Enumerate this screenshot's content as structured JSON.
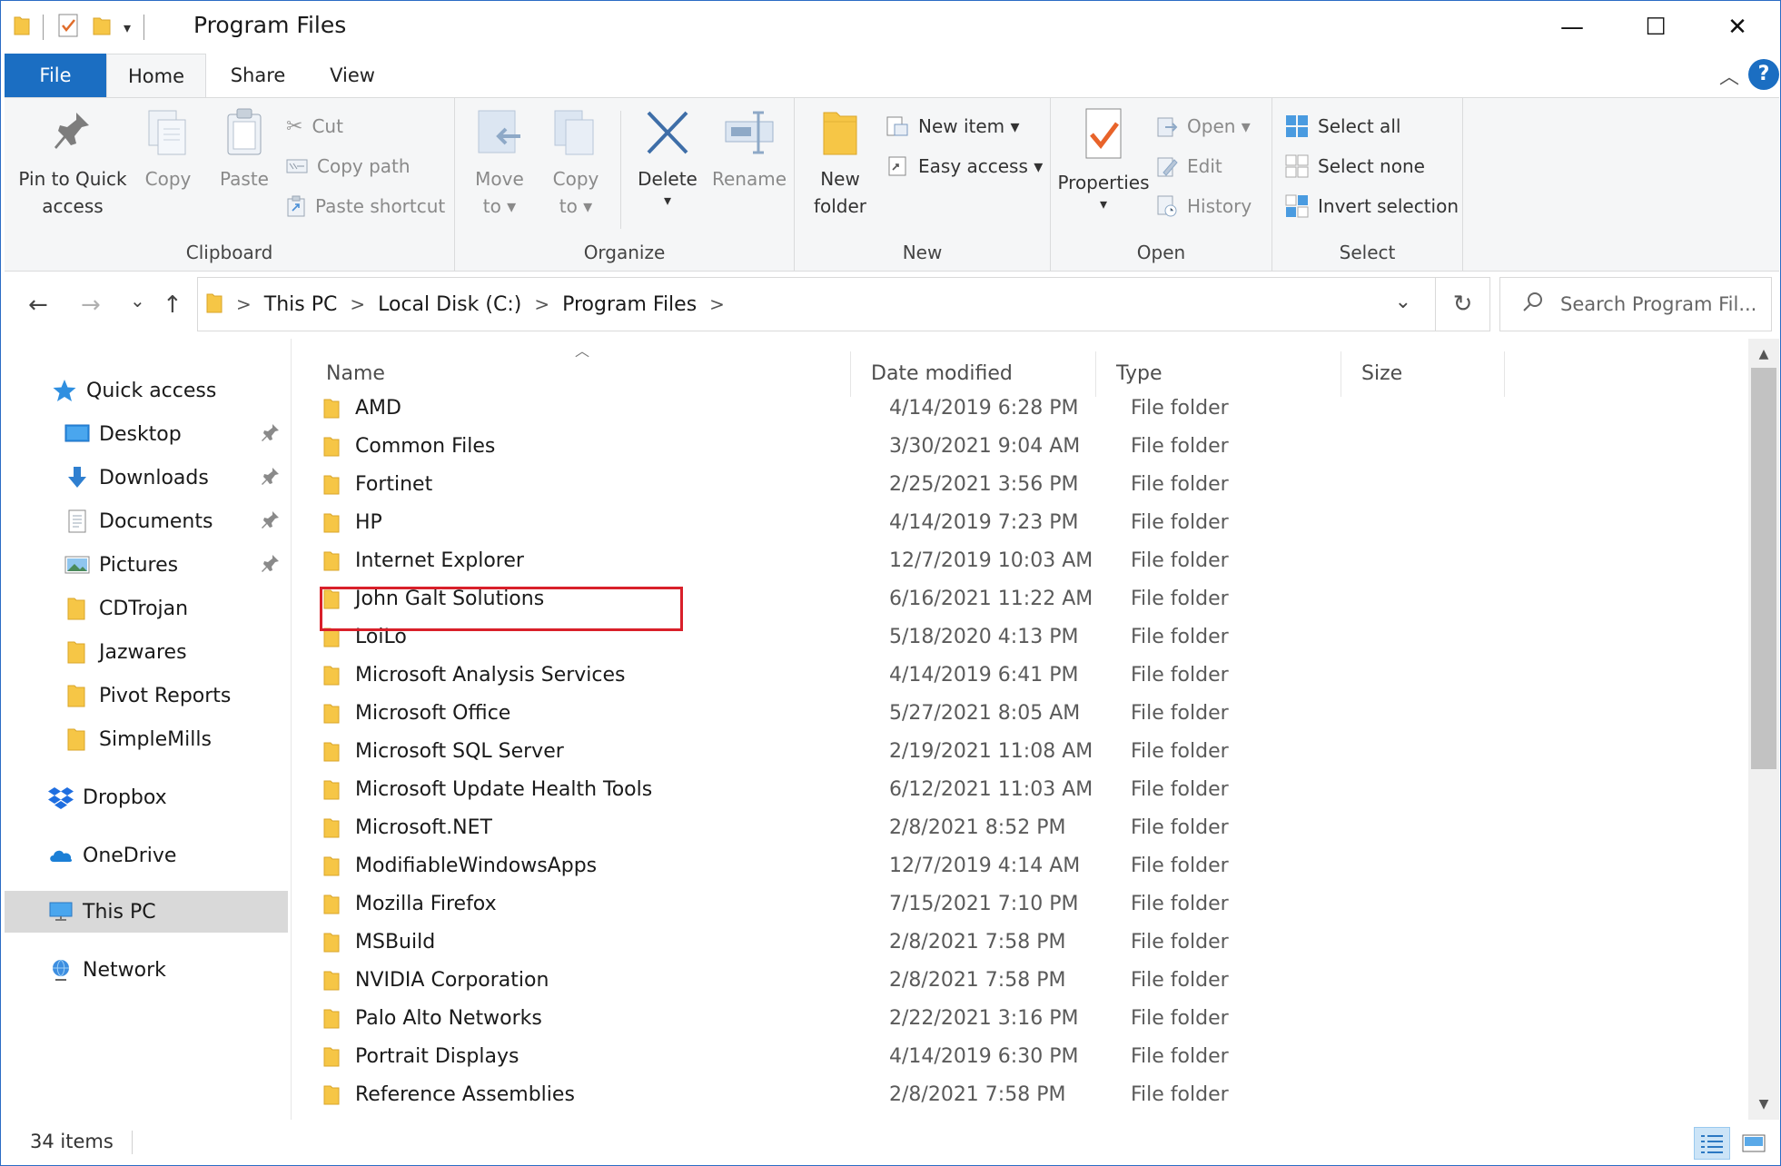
{
  "window": {
    "title": "Program Files",
    "minimize_glyph": "—",
    "maximize_glyph": "☐",
    "close_glyph": "✕"
  },
  "ribbon_tabs": {
    "file": "File",
    "home": "Home",
    "share": "Share",
    "view": "View",
    "collapse_glyph": "︿",
    "help_glyph": "?"
  },
  "ribbon": {
    "clipboard": {
      "label": "Clipboard",
      "pin_line1": "Pin to Quick",
      "pin_line2": "access",
      "copy": "Copy",
      "paste": "Paste",
      "cut": "Cut",
      "copy_path": "Copy path",
      "paste_shortcut": "Paste shortcut"
    },
    "organize": {
      "label": "Organize",
      "move_line1": "Move",
      "move_line2": "to ▾",
      "copy_line1": "Copy",
      "copy_line2": "to ▾",
      "delete": "Delete",
      "delete_arrow": "▾",
      "rename": "Rename"
    },
    "new": {
      "label": "New",
      "folder_line1": "New",
      "folder_line2": "folder",
      "new_item": "New item ▾",
      "easy_access": "Easy access ▾"
    },
    "open": {
      "label": "Open",
      "properties": "Properties",
      "properties_arrow": "▾",
      "open": "Open ▾",
      "edit": "Edit",
      "history": "History"
    },
    "select": {
      "label": "Select",
      "select_all": "Select all",
      "select_none": "Select none",
      "invert": "Invert selection"
    }
  },
  "nav": {
    "back": "←",
    "forward": "→",
    "recent": "⌄",
    "up": "↑",
    "breadcrumbs": [
      "This PC",
      "Local Disk (C:)",
      "Program Files"
    ],
    "chevron": ">",
    "dropdown": "⌄",
    "refresh": "↻",
    "search_placeholder": "Search Program Fil..."
  },
  "sidebar": {
    "quick_access": "Quick access",
    "items": [
      {
        "label": "Desktop",
        "pinned": true
      },
      {
        "label": "Downloads",
        "pinned": true
      },
      {
        "label": "Documents",
        "pinned": true
      },
      {
        "label": "Pictures",
        "pinned": true
      },
      {
        "label": "CDTrojan",
        "pinned": false
      },
      {
        "label": "Jazwares",
        "pinned": false
      },
      {
        "label": "Pivot Reports",
        "pinned": false
      },
      {
        "label": "SimpleMills",
        "pinned": false
      }
    ],
    "dropbox": "Dropbox",
    "onedrive": "OneDrive",
    "this_pc": "This PC",
    "network": "Network"
  },
  "columns": {
    "name": "Name",
    "date": "Date modified",
    "type": "Type",
    "size": "Size",
    "sort_glyph": "︿"
  },
  "files": [
    {
      "name": "AMD",
      "date": "4/14/2019 6:28 PM",
      "type": "File folder"
    },
    {
      "name": "Common Files",
      "date": "3/30/2021 9:04 AM",
      "type": "File folder"
    },
    {
      "name": "Fortinet",
      "date": "2/25/2021 3:56 PM",
      "type": "File folder"
    },
    {
      "name": "HP",
      "date": "4/14/2019 7:23 PM",
      "type": "File folder"
    },
    {
      "name": "Internet Explorer",
      "date": "12/7/2019 10:03 AM",
      "type": "File folder"
    },
    {
      "name": "John Galt Solutions",
      "date": "6/16/2021 11:22 AM",
      "type": "File folder"
    },
    {
      "name": "LoiLo",
      "date": "5/18/2020 4:13 PM",
      "type": "File folder"
    },
    {
      "name": "Microsoft Analysis Services",
      "date": "4/14/2019 6:41 PM",
      "type": "File folder"
    },
    {
      "name": "Microsoft Office",
      "date": "5/27/2021 8:05 AM",
      "type": "File folder"
    },
    {
      "name": "Microsoft SQL Server",
      "date": "2/19/2021 11:08 AM",
      "type": "File folder"
    },
    {
      "name": "Microsoft Update Health Tools",
      "date": "6/12/2021 11:03 AM",
      "type": "File folder"
    },
    {
      "name": "Microsoft.NET",
      "date": "2/8/2021 8:52 PM",
      "type": "File folder"
    },
    {
      "name": "ModifiableWindowsApps",
      "date": "12/7/2019 4:14 AM",
      "type": "File folder"
    },
    {
      "name": "Mozilla Firefox",
      "date": "7/15/2021 7:10 PM",
      "type": "File folder"
    },
    {
      "name": "MSBuild",
      "date": "2/8/2021 7:58 PM",
      "type": "File folder"
    },
    {
      "name": "NVIDIA Corporation",
      "date": "2/8/2021 7:58 PM",
      "type": "File folder"
    },
    {
      "name": "Palo Alto Networks",
      "date": "2/22/2021 3:16 PM",
      "type": "File folder"
    },
    {
      "name": "Portrait Displays",
      "date": "4/14/2019 6:30 PM",
      "type": "File folder"
    },
    {
      "name": "Reference Assemblies",
      "date": "2/8/2021 7:58 PM",
      "type": "File folder"
    }
  ],
  "scroll": {
    "up": "▲",
    "down": "▼"
  },
  "status": {
    "count": "34 items"
  },
  "colors": {
    "accent": "#1b6ec2",
    "folder": "#f6c646",
    "highlight_box": "#d9202a",
    "selected_nav": "#d9d9d9"
  }
}
